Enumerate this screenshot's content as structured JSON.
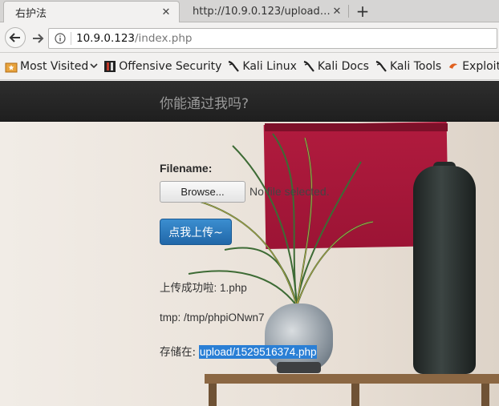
{
  "tabs": [
    {
      "title": "右护法",
      "active": true
    },
    {
      "title": "http://10.9.0.123/upload/...",
      "active": false
    }
  ],
  "url": {
    "host": "10.9.0.123",
    "path": "/index.php"
  },
  "bookmarks": [
    {
      "label": "Most Visited",
      "icon": "star-folder-icon"
    },
    {
      "label": "Offensive Security",
      "icon": "offsec-icon"
    },
    {
      "label": "Kali Linux",
      "icon": "kali-dragon-icon"
    },
    {
      "label": "Kali Docs",
      "icon": "kali-dragon-icon"
    },
    {
      "label": "Kali Tools",
      "icon": "kali-dragon-icon"
    },
    {
      "label": "Exploit-DB",
      "icon": "exploitdb-icon"
    }
  ],
  "page": {
    "brand": "你能通过我吗?",
    "filename_label": "Filename:",
    "browse_label": "Browse...",
    "no_file": "No file selected.",
    "submit_label": "点我上传~",
    "result_line1": "上传成功啦: 1.php",
    "result_line2": "tmp: /tmp/phpiONwn7",
    "result_line3_prefix": "存储在:",
    "result_line3_path": "upload/1529516374.php"
  },
  "colors": {
    "highlight": "#2a7fd5",
    "submit": "#2a74b8",
    "topbar": "#262626"
  }
}
